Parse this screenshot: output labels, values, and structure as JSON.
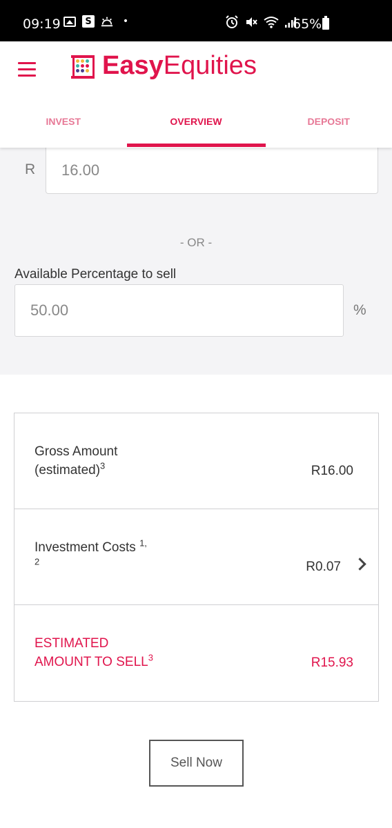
{
  "status_bar": {
    "time": "09:19",
    "battery": "65%",
    "left_icons": [
      "gallery-icon",
      "s-badge-icon",
      "weather-icon",
      "dot-icon"
    ],
    "right_icons": [
      "alarm-icon",
      "mute-icon",
      "wifi-icon",
      "signal-icon",
      "battery-icon"
    ],
    "s_badge": "S",
    "dot": "•"
  },
  "header": {
    "brand_bold": "Easy",
    "brand_light": "Equities",
    "accent_color": "#e0144c"
  },
  "tabs": [
    {
      "label": "INVEST"
    },
    {
      "label": "OVERVIEW",
      "active": true
    },
    {
      "label": "DEPOSIT"
    }
  ],
  "form": {
    "currency_symbol": "R",
    "amount_value": "16.00",
    "or_text": "- OR -",
    "percentage_label": "Available Percentage to sell",
    "percentage_value": "50.00",
    "percentage_symbol": "%"
  },
  "summary": {
    "gross_label_1": "Gross Amount",
    "gross_label_2": "(estimated)",
    "gross_sup": "3",
    "gross_value": "R16.00",
    "costs_label": "Investment Costs",
    "costs_sup_1": "1,",
    "costs_sup_2": "2",
    "costs_value": "R0.07",
    "est_label_1": "ESTIMATED",
    "est_label_2": "AMOUNT TO SELL",
    "est_sup": "3",
    "est_value": "R15.93"
  },
  "actions": {
    "sell_label": "Sell Now"
  }
}
